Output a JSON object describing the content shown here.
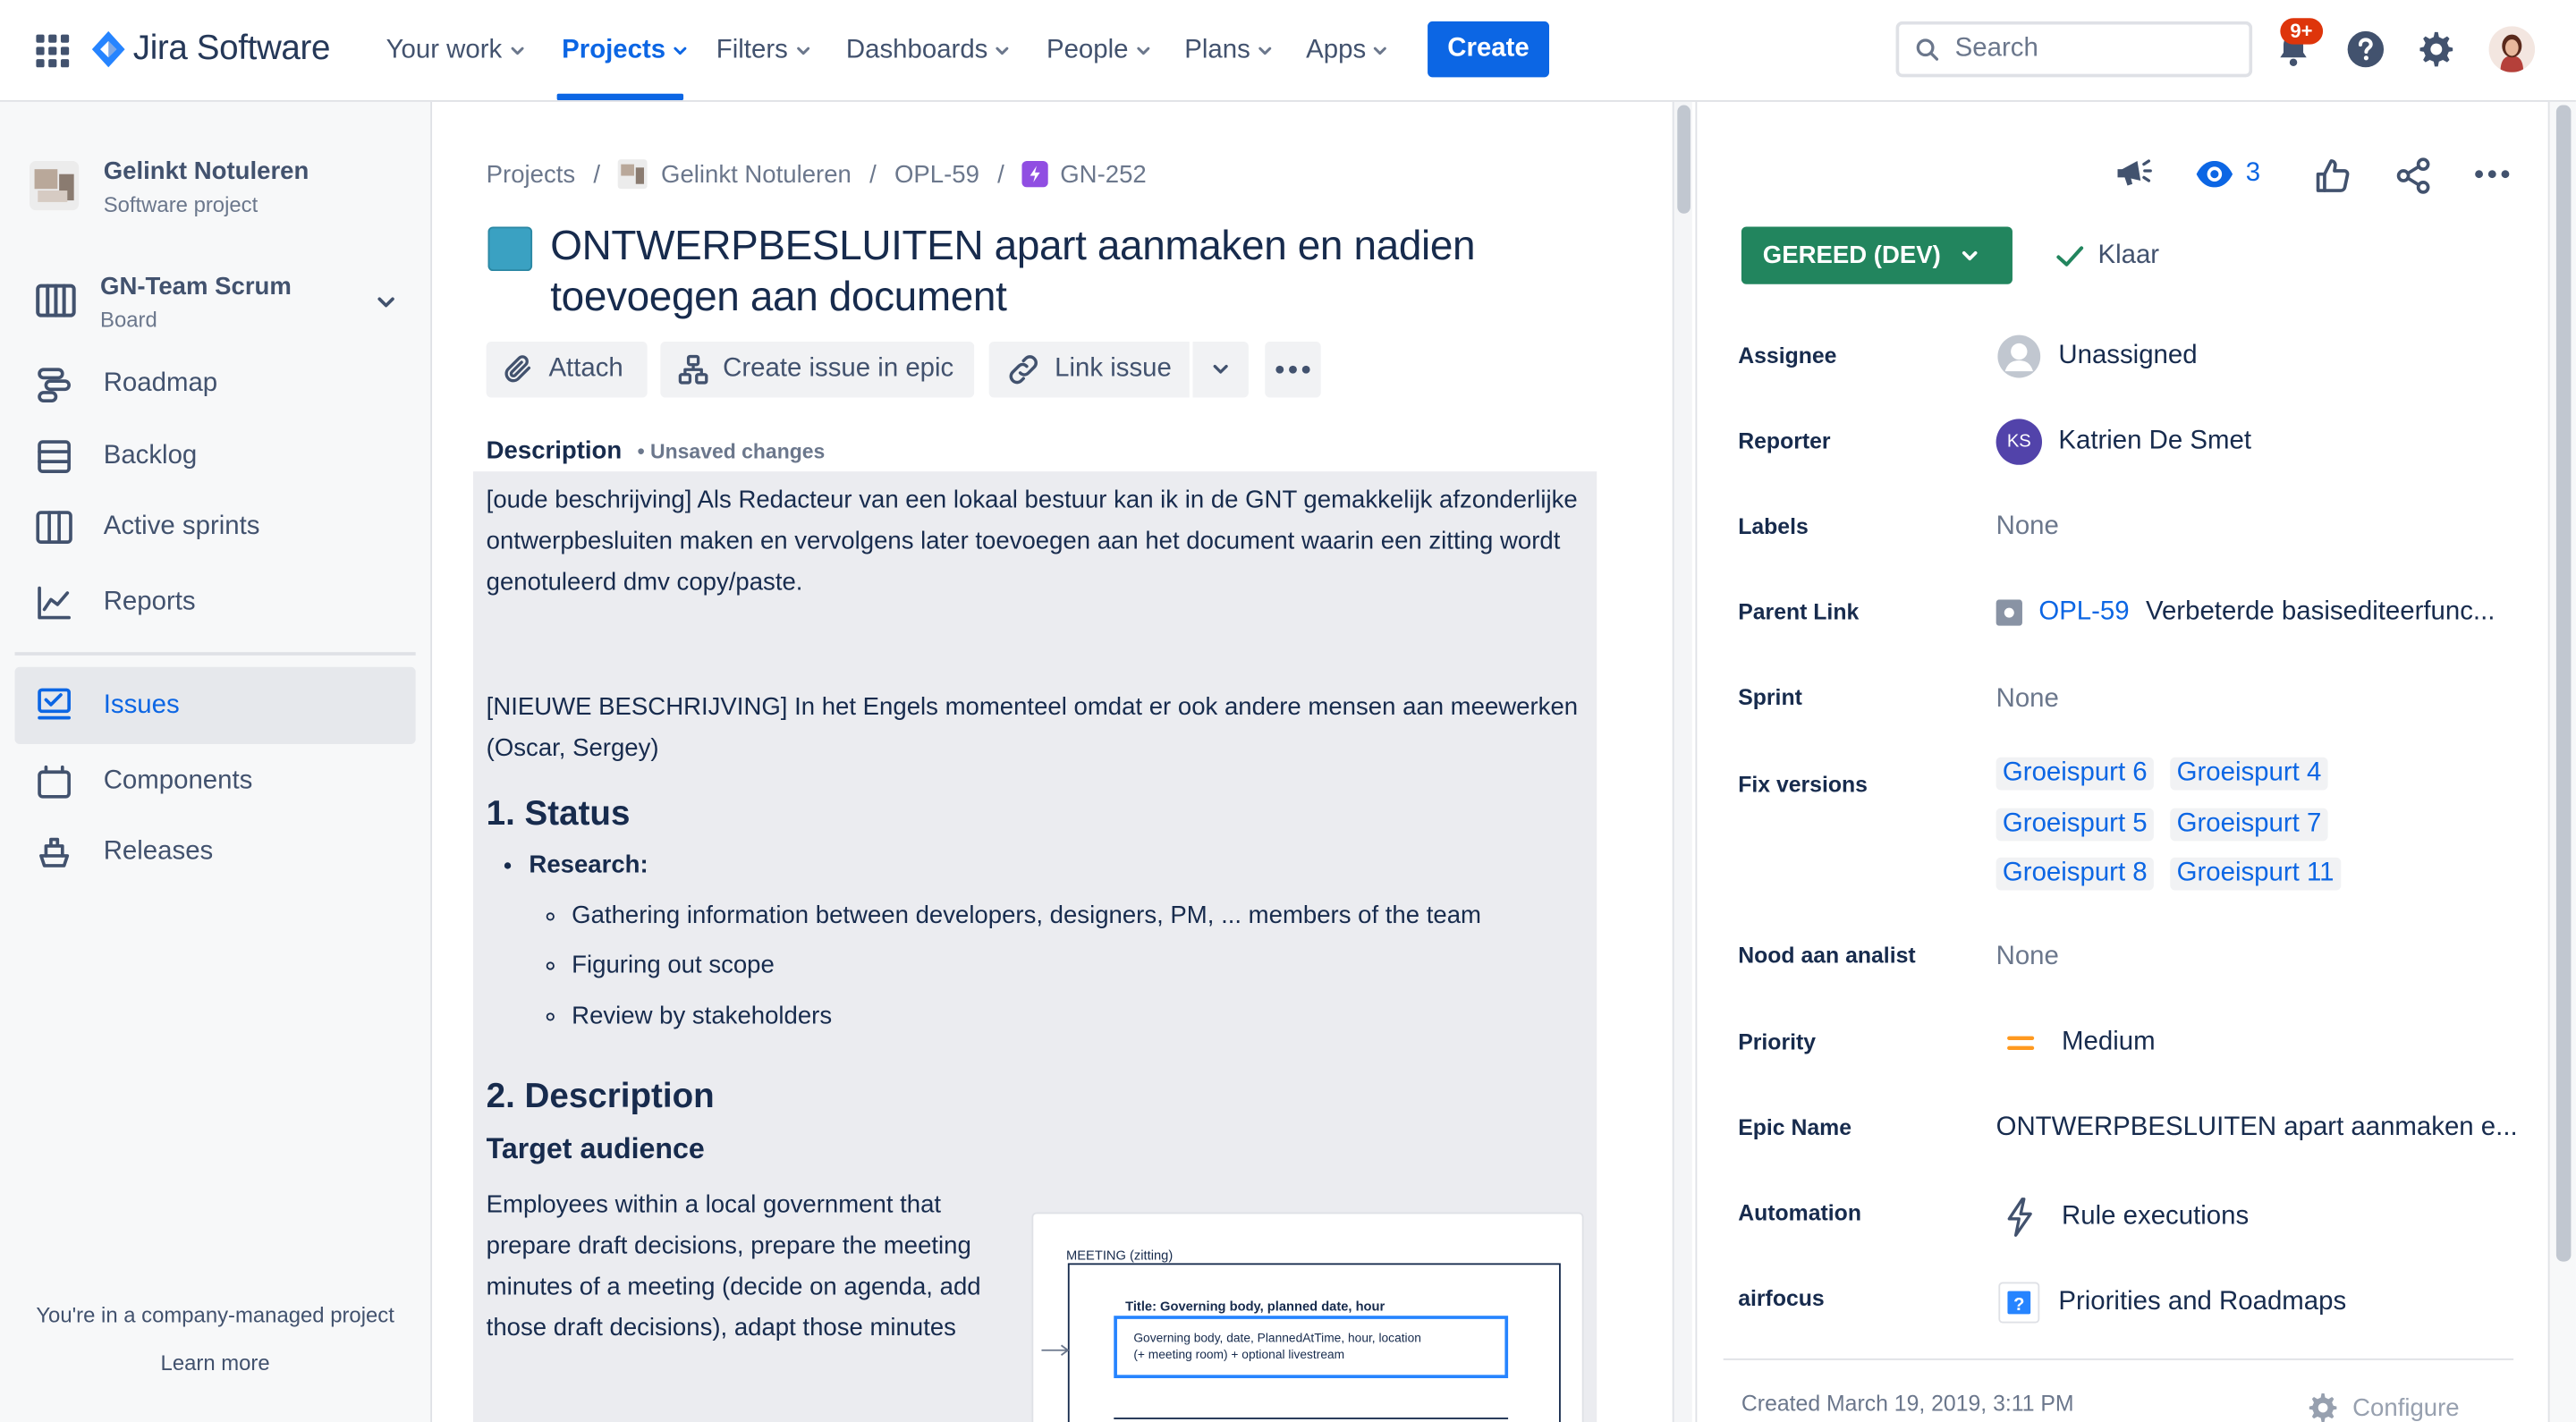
{
  "topnav": {
    "product": "Jira Software",
    "items": [
      {
        "label": "Your work"
      },
      {
        "label": "Projects"
      },
      {
        "label": "Filters"
      },
      {
        "label": "Dashboards"
      },
      {
        "label": "People"
      },
      {
        "label": "Plans"
      },
      {
        "label": "Apps"
      }
    ],
    "create_label": "Create",
    "search_placeholder": "Search",
    "notification_badge": "9+",
    "accent_color": "#0c66e4"
  },
  "sidebar": {
    "project_name": "Gelinkt Notuleren",
    "project_type": "Software project",
    "board_name": "GN-Team Scrum",
    "board_sub": "Board",
    "items": [
      {
        "label": "Roadmap",
        "icon": "roadmap-icon"
      },
      {
        "label": "Backlog",
        "icon": "backlog-icon"
      },
      {
        "label": "Active sprints",
        "icon": "active-sprints-icon"
      },
      {
        "label": "Reports",
        "icon": "reports-icon"
      },
      {
        "label": "Issues",
        "icon": "issues-icon",
        "active": true
      },
      {
        "label": "Components",
        "icon": "components-icon"
      },
      {
        "label": "Releases",
        "icon": "releases-icon"
      }
    ],
    "footer_text": "You're in a company-managed project",
    "learn_more": "Learn more"
  },
  "issue": {
    "breadcrumb": [
      "Projects",
      "Gelinkt Notuleren",
      "OPL-59",
      "GN-252"
    ],
    "title": "ONTWERPBESLUITEN apart aanmaken en nadien toevoegen aan document",
    "actions": {
      "attach": "Attach",
      "create_in_epic": "Create issue in epic",
      "link_issue": "Link issue"
    },
    "description_label": "Description",
    "unsaved": "• Unsaved changes",
    "description": {
      "p1": "[oude beschrijving] Als Redacteur van een lokaal bestuur kan ik in de GNT gemakkelijk afzonderlijke ontwerpbesluiten maken en vervolgens later toevoegen aan het document waarin een zitting wordt genotuleerd dmv copy/paste.",
      "p2": "[NIEUWE BESCHRIJVING] In het Engels momenteel omdat er ook andere mensen aan meewerken (Oscar, Sergey)",
      "h_status": "1. Status",
      "research": "Research:",
      "research_items": [
        "Gathering information between developers, designers, PM, ... members of the team",
        "Figuring out scope",
        "Review by stakeholders"
      ],
      "h_description": "2. Description",
      "h_target": "Target audience",
      "target_text": "Employees within a local government that prepare draft decisions, prepare the meeting minutes of a meeting (decide on agenda, add those draft decisions), adapt those minutes",
      "mockup": {
        "header": "MEETING (zitting)",
        "title": "Title: Governing body, planned date, hour",
        "box_line1": "Governing body, date, PlannedAtTime, hour, location",
        "box_line2": "(+ meeting room) + optional livestream"
      }
    }
  },
  "panel": {
    "watch_count": "3",
    "status": "GEREED (DEV)",
    "status_color": "#22855e",
    "resolution": "Klaar",
    "fields": {
      "assignee_label": "Assignee",
      "assignee": "Unassigned",
      "reporter_label": "Reporter",
      "reporter": "Katrien De Smet",
      "reporter_initials": "KS",
      "labels_label": "Labels",
      "labels": "None",
      "parent_label": "Parent Link",
      "parent_key": "OPL-59",
      "parent_title": "Verbeterde basisediteerfunc...",
      "sprint_label": "Sprint",
      "sprint": "None",
      "fix_label": "Fix versions",
      "fix_versions": [
        "Groeispurt 6",
        "Groeispurt 4",
        "Groeispurt 5",
        "Groeispurt 7",
        "Groeispurt 8",
        "Groeispurt 11"
      ],
      "analist_label": "Nood aan analist",
      "analist": "None",
      "priority_label": "Priority",
      "priority": "Medium",
      "epic_label": "Epic Name",
      "epic": "ONTWERPBESLUITEN apart aanmaken e...",
      "automation_label": "Automation",
      "automation": "Rule executions",
      "airfocus_label": "airfocus",
      "airfocus": "Priorities and Roadmaps"
    },
    "created": "Created March 19, 2019, 3:11 PM",
    "configure": "Configure"
  }
}
